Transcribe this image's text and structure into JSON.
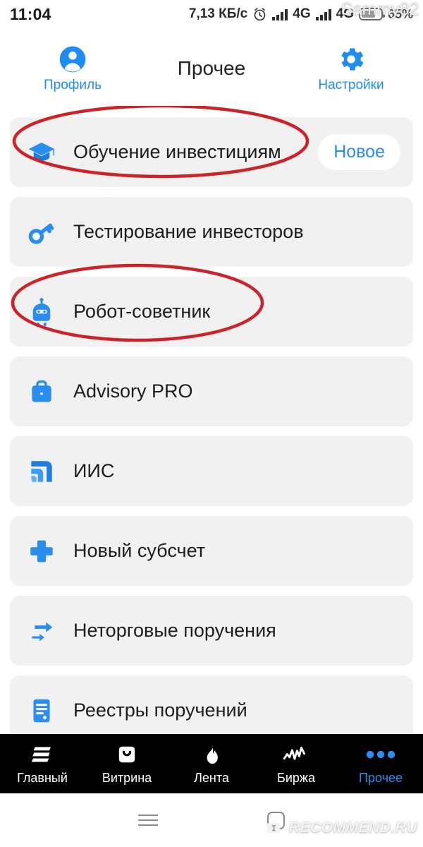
{
  "status_bar": {
    "time": "11:04",
    "data_rate": "7,13 КБ/с",
    "alarm_icon": "alarm-clock-icon",
    "network_1": "4G",
    "network_2": "4G",
    "battery_percent": "65%",
    "user_watermark": "Sammy82"
  },
  "header": {
    "profile_label": "Профиль",
    "profile_icon": "user-avatar-icon",
    "title": "Прочее",
    "settings_label": "Настройки",
    "settings_icon": "gear-icon"
  },
  "menu": {
    "items": [
      {
        "label": "Обучение инвестициям",
        "icon": "graduation-cap-icon",
        "badge": "Новое",
        "annotated": true
      },
      {
        "label": "Тестирование инвесторов",
        "icon": "key-icon",
        "badge": "",
        "annotated": false
      },
      {
        "label": "Робот-советник",
        "icon": "robot-icon",
        "badge": "",
        "annotated": true
      },
      {
        "label": "Advisory PRO",
        "icon": "briefcase-icon",
        "badge": "",
        "annotated": false
      },
      {
        "label": "ИИС",
        "icon": "growth-steps-icon",
        "badge": "",
        "annotated": false
      },
      {
        "label": "Новый субсчет",
        "icon": "plus-icon",
        "badge": "",
        "annotated": false
      },
      {
        "label": "Неторговые поручения",
        "icon": "transfer-arrows-icon",
        "badge": "",
        "annotated": false
      },
      {
        "label": "Реестры поручений",
        "icon": "document-list-icon",
        "badge": "",
        "annotated": false
      }
    ]
  },
  "tabbar": {
    "tabs": [
      {
        "label": "Главный",
        "icon": "stacked-lines-icon",
        "active": false
      },
      {
        "label": "Витрина",
        "icon": "shopping-bag-icon",
        "active": false
      },
      {
        "label": "Лента",
        "icon": "flame-icon",
        "active": false
      },
      {
        "label": "Биржа",
        "icon": "chart-line-icon",
        "active": false
      },
      {
        "label": "Прочее",
        "icon": "three-dots-icon",
        "active": true
      }
    ]
  },
  "nav_bar": {
    "recents_icon": "recents-menu-icon",
    "home_icon": "home-square-icon",
    "site_watermark": "RECOMMEND.RU"
  },
  "colors": {
    "accent_blue": "#2a8ef0",
    "row_background": "#f1f1f1",
    "annotation_red": "#cc2229",
    "tabbar_background": "#000000"
  }
}
